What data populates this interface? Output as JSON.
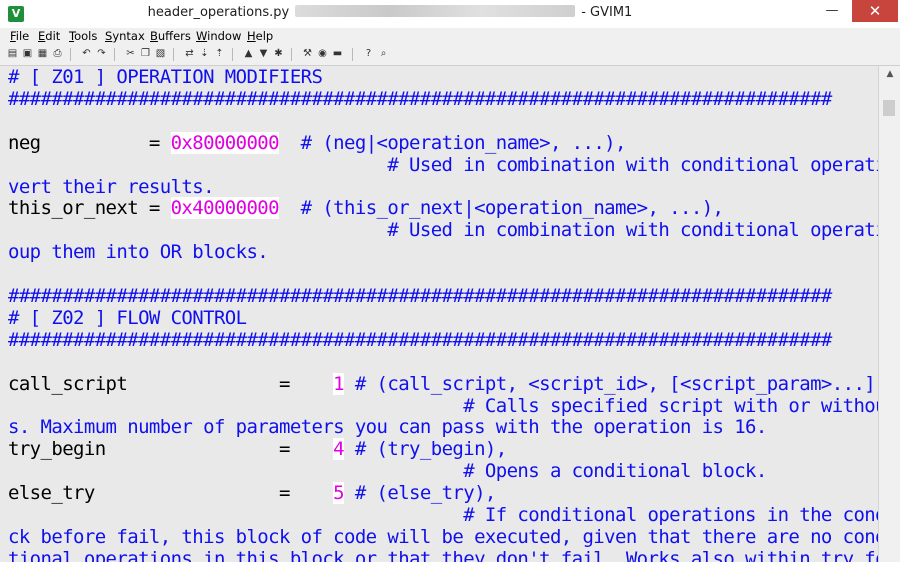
{
  "window": {
    "file_name": "header_operations.py",
    "app_name": "- GVIM1",
    "min_glyph": "—",
    "max_glyph": "☐",
    "close_glyph": "✕",
    "app_icon_glyph": "V"
  },
  "menu": [
    "File",
    "Edit",
    "Tools",
    "Syntax",
    "Buffers",
    "Window",
    "Help"
  ],
  "toolbar_icons": [
    "open-icon",
    "save-icon",
    "save-all-icon",
    "print-icon",
    "undo-icon",
    "redo-icon",
    "cut-icon",
    "copy-icon",
    "paste-icon",
    "find-replace-icon",
    "find-next-icon",
    "find-prev-icon",
    "load-session-icon",
    "save-session-icon",
    "run-script-icon",
    "make-icon",
    "build-tags-icon",
    "jump-tag-icon",
    "help-icon",
    "find-help-icon"
  ],
  "editor": {
    "lines": [
      [
        {
          "t": "# [ Z01 ] OPERATION MODIFIERS",
          "k": "c"
        }
      ],
      [
        {
          "t": "############################################################################",
          "k": "c"
        }
      ],
      [],
      [
        {
          "t": "neg          = ",
          "k": "n"
        },
        {
          "t": "0x80000000",
          "k": "hex"
        },
        {
          "t": "  # (neg|<operation_name>, ...),",
          "k": "c"
        }
      ],
      [
        {
          "t": "                                   # Used in combination with conditional operations to in",
          "k": "c"
        }
      ],
      [
        {
          "t": "vert their results.",
          "k": "c"
        }
      ],
      [
        {
          "t": "this_or_next = ",
          "k": "n"
        },
        {
          "t": "0x40000000",
          "k": "hex"
        },
        {
          "t": "  # (this_or_next|<operation_name>, ...),",
          "k": "c"
        }
      ],
      [
        {
          "t": "                                   # Used in combination with conditional operations to gr",
          "k": "c"
        }
      ],
      [
        {
          "t": "oup them into OR blocks.",
          "k": "c"
        }
      ],
      [],
      [
        {
          "t": "############################################################################",
          "k": "c"
        }
      ],
      [
        {
          "t": "# [ Z02 ] FLOW CONTROL",
          "k": "c"
        }
      ],
      [
        {
          "t": "############################################################################",
          "k": "c"
        }
      ],
      [],
      [
        {
          "t": "call_script              =    ",
          "k": "n"
        },
        {
          "t": "1",
          "k": "hex"
        },
        {
          "t": " # (call_script, <script_id>, [<script_param>...]),",
          "k": "c"
        }
      ],
      [
        {
          "t": "                                          # Calls specified script with or without parameter",
          "k": "c"
        }
      ],
      [
        {
          "t": "s. Maximum number of parameters you can pass with the operation is 16.",
          "k": "c"
        }
      ],
      [
        {
          "t": "try_begin                =    ",
          "k": "n"
        },
        {
          "t": "4",
          "k": "hex"
        },
        {
          "t": " # (try_begin),",
          "k": "c"
        }
      ],
      [
        {
          "t": "                                          # Opens a conditional block.",
          "k": "c"
        }
      ],
      [
        {
          "t": "else_try                 =    ",
          "k": "n"
        },
        {
          "t": "5",
          "k": "hex"
        },
        {
          "t": " # (else_try),",
          "k": "c"
        }
      ],
      [
        {
          "t": "                                          # If conditional operations in the conditional blo",
          "k": "c"
        }
      ],
      [
        {
          "t": "ck before fail, this block of code will be executed, given that there are no condi",
          "k": "c"
        }
      ],
      [
        {
          "t": "tional operations in this block or that they don't fail. Works also within try_for",
          "k": "c"
        }
      ]
    ]
  }
}
